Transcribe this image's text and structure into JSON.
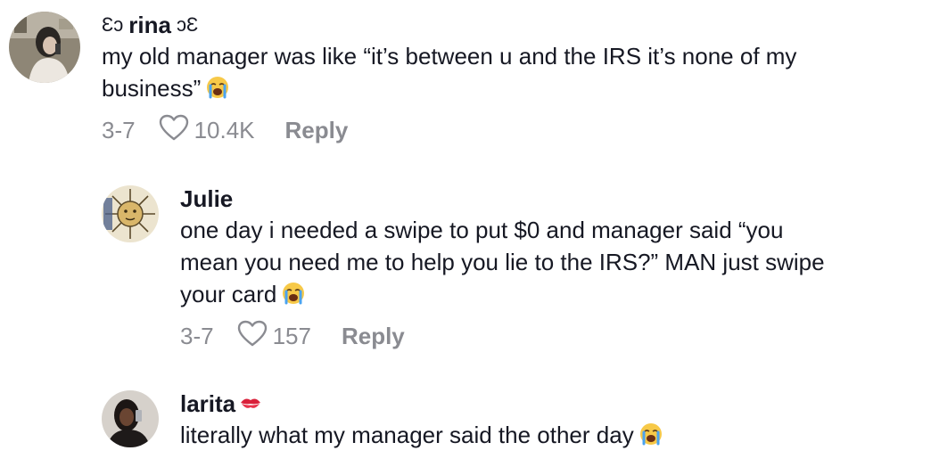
{
  "comments": [
    {
      "user_prefix": "Ɛɔ",
      "username": "rina",
      "user_suffix": "ɔƐ",
      "text_line1": "my old manager was like “it’s between u and the IRS it’s none of my",
      "text_line2": "business”",
      "emoji": "loudly-crying-face-icon",
      "date": "3-7",
      "likes": "10.4K",
      "reply_label": "Reply"
    },
    {
      "username": "Julie",
      "text_line1": "one day i needed a swipe to put $0 and manager said “you",
      "text_line2": "mean you need me to help you lie to the IRS?” MAN just swipe",
      "text_line3": "your card",
      "emoji": "loudly-crying-face-icon",
      "date": "3-7",
      "likes": "157",
      "reply_label": "Reply"
    },
    {
      "username": "larita",
      "username_emoji": "kiss-mark-icon",
      "text_line1": "literally what my manager said the other day",
      "emoji": "loudly-crying-face-icon"
    }
  ],
  "colors": {
    "text": "#161823",
    "meta": "#8a8b91"
  }
}
